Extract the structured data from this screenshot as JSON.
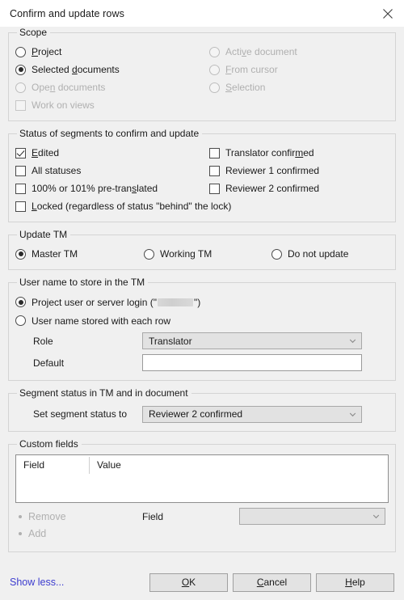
{
  "window": {
    "title": "Confirm and update rows",
    "close_icon": "close-icon"
  },
  "scope": {
    "legend": "Scope",
    "options_left": [
      {
        "label": "Project",
        "accel": "P",
        "selected": false,
        "disabled": false,
        "type": "radio"
      },
      {
        "label": "Selected documents",
        "accel": "d",
        "selected": true,
        "disabled": false,
        "type": "radio"
      },
      {
        "label": "Open documents",
        "accel": "n",
        "selected": false,
        "disabled": true,
        "type": "radio"
      },
      {
        "label": "Work on views",
        "accel": "",
        "selected": false,
        "disabled": true,
        "type": "checkbox"
      }
    ],
    "options_right": [
      {
        "label": "Active document",
        "accel": "v",
        "selected": false,
        "disabled": true,
        "type": "radio"
      },
      {
        "label": "From cursor",
        "accel": "F",
        "selected": false,
        "disabled": true,
        "type": "radio"
      },
      {
        "label": "Selection",
        "accel": "S",
        "selected": false,
        "disabled": true,
        "type": "radio"
      }
    ]
  },
  "status": {
    "legend": "Status of segments to confirm and update",
    "options_left": [
      {
        "label": "Edited",
        "accel": "E",
        "checked": true,
        "disabled": false
      },
      {
        "label": "All statuses",
        "accel": "",
        "checked": false,
        "disabled": false
      },
      {
        "label": "100% or 101% pre-translated",
        "accel": "s",
        "checked": false,
        "disabled": false
      },
      {
        "label": "Locked (regardless of status \"behind\" the lock)",
        "accel": "L",
        "checked": false,
        "disabled": false
      }
    ],
    "options_right": [
      {
        "label": "Translator confirmed",
        "accel": "m",
        "checked": false,
        "disabled": false
      },
      {
        "label": "Reviewer 1 confirmed",
        "accel": "",
        "checked": false,
        "disabled": false
      },
      {
        "label": "Reviewer 2 confirmed",
        "accel": "",
        "checked": false,
        "disabled": false
      }
    ]
  },
  "update_tm": {
    "legend": "Update TM",
    "options": [
      {
        "label": "Master TM",
        "selected": true
      },
      {
        "label": "Working TM",
        "selected": false
      },
      {
        "label": "Do not update",
        "selected": false
      }
    ]
  },
  "user_name": {
    "legend": "User name to store in the TM",
    "project_user_prefix": "Project user or server login (\"",
    "project_user_suffix": "\")",
    "project_user_selected": true,
    "project_user_redacted": true,
    "stored_with_row_label": "User name stored with each row",
    "stored_with_row_selected": false,
    "role_label": "Role",
    "role_value": "Translator",
    "role_disabled": true,
    "default_label": "Default",
    "default_value": "",
    "default_placeholder": ""
  },
  "segment_status": {
    "legend": "Segment status in TM and in document",
    "label": "Set segment status to",
    "value": "Reviewer 2 confirmed",
    "disabled": true
  },
  "custom_fields": {
    "legend": "Custom fields",
    "columns": [
      "Field",
      "Value"
    ],
    "rows": [],
    "remove_label": "Remove",
    "add_label": "Add",
    "field_label": "Field",
    "field_value": "",
    "field_disabled": true
  },
  "footer": {
    "show_less": "Show less...",
    "ok": "OK",
    "ok_accel": "O",
    "cancel": "Cancel",
    "cancel_accel": "C",
    "help": "Help",
    "help_accel": "H"
  },
  "colors": {
    "body_background": "#f0f0f0",
    "titlebar_background": "#ffffff",
    "link": "#3c3ccf",
    "disabled_text": "#b0b0b0",
    "text": "#1a1a1a"
  }
}
